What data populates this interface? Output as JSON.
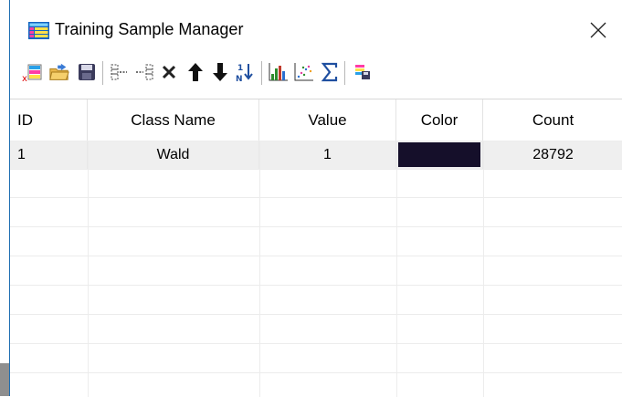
{
  "window": {
    "title": "Training Sample Manager",
    "accent": "#1f6fb2"
  },
  "toolbar": {
    "buttons": [
      {
        "name": "new-sample-icon"
      },
      {
        "name": "open-folder-icon"
      },
      {
        "name": "save-icon"
      },
      {
        "name": "merge-classes-icon"
      },
      {
        "name": "split-class-icon"
      },
      {
        "name": "delete-icon"
      },
      {
        "name": "move-up-icon"
      },
      {
        "name": "move-down-icon"
      },
      {
        "name": "sort-icon"
      },
      {
        "name": "histogram-icon"
      },
      {
        "name": "scatter-plot-icon"
      },
      {
        "name": "statistics-sigma-icon"
      },
      {
        "name": "export-icon"
      }
    ]
  },
  "table": {
    "columns": [
      "ID",
      "Class Name",
      "Value",
      "Color",
      "Count"
    ],
    "rows": [
      {
        "id": "1",
        "class_name": "Wald",
        "value": "1",
        "color": "#150f2a",
        "count": "28792"
      }
    ]
  }
}
